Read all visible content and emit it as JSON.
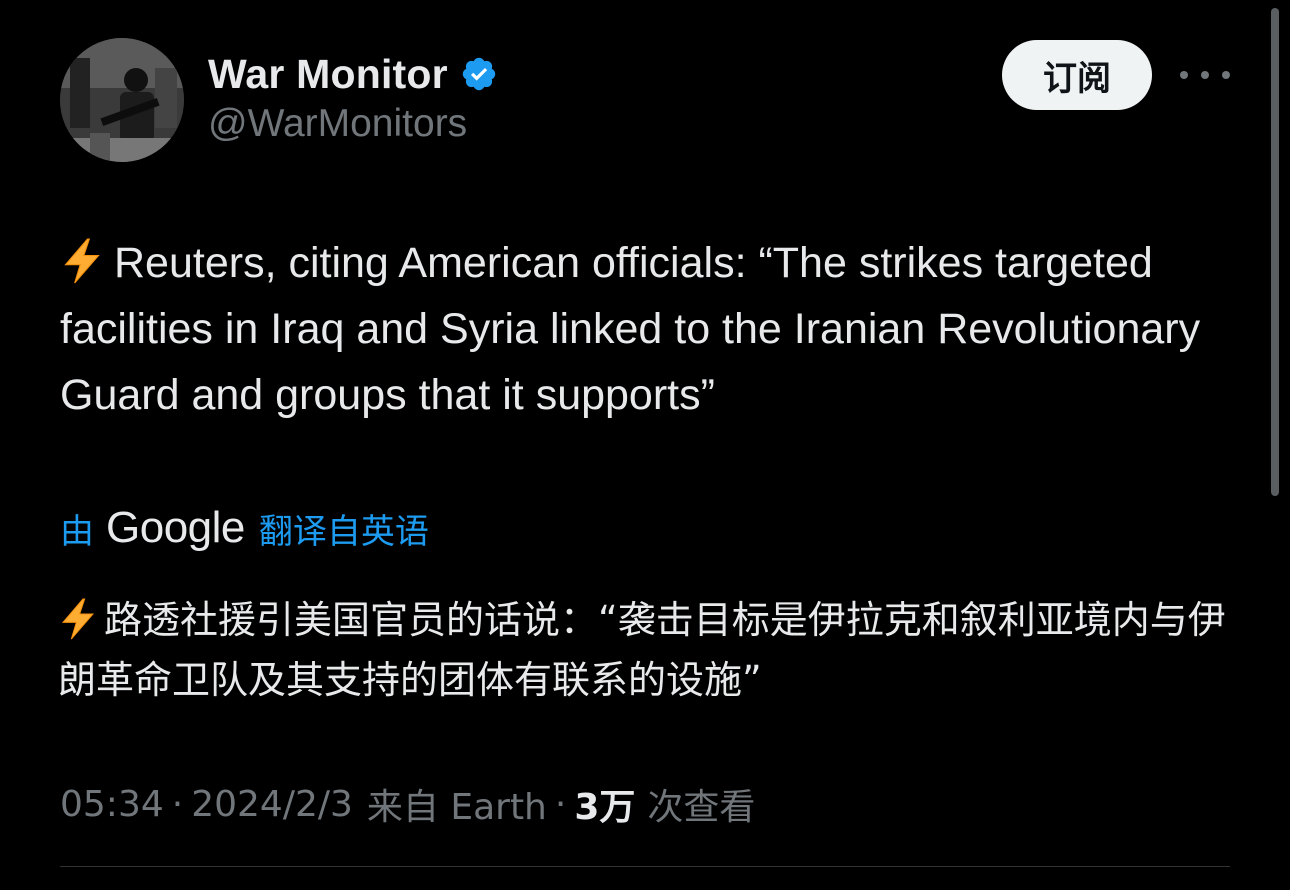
{
  "tweet": {
    "author": {
      "display_name": "War Monitor",
      "handle": "@WarMonitors",
      "verified_icon": "verified-badge-icon",
      "avatar": "avatar"
    },
    "subscribe_label": "订阅",
    "more_icon": "more-horizontal-icon",
    "text_emoji": "lightning-bolt-emoji",
    "text": "Reuters, citing American officials: “The strikes targeted facilities in Iraq and Syria linked to the Iranian Revolutionary Guard and groups that it supports”",
    "translation": {
      "prefix": "由",
      "provider": "Google",
      "suffix": "翻译自英语",
      "text": "路透社援引美国官员的话说：“袭击目标是伊拉克和叙利亚境内与伊朗革命卫队及其支持的团体有联系的设施”"
    },
    "meta": {
      "time": "05:34",
      "date": "2024/2/3",
      "source": "来自 Earth",
      "views_count": "3万",
      "views_label": "次查看",
      "separator": "·"
    }
  },
  "colors": {
    "background": "#000000",
    "text_primary": "#e7e9ea",
    "text_secondary": "#71767b",
    "accent": "#1d9bf0",
    "button_bg": "#eff3f4",
    "divider": "#2f3336"
  }
}
